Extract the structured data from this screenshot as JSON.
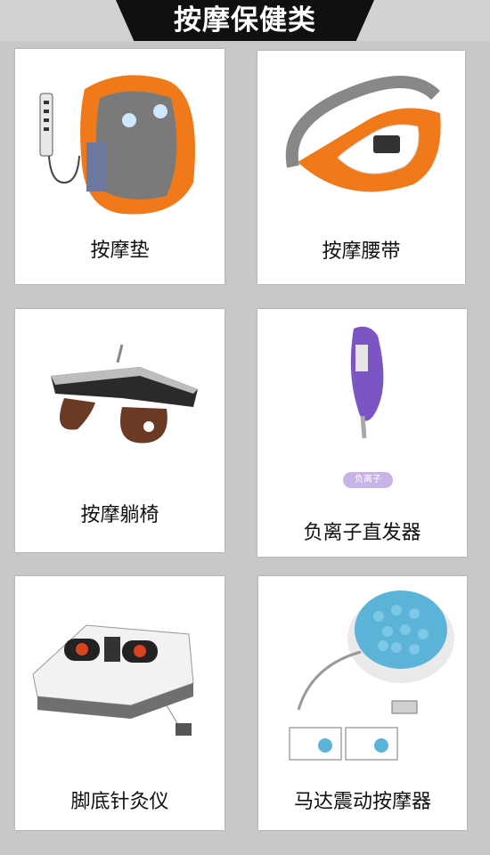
{
  "header": {
    "title": "按摩保健类"
  },
  "products": [
    {
      "label": "按摩垫"
    },
    {
      "label": "按摩腰带"
    },
    {
      "label": "按摩躺椅"
    },
    {
      "label": "负离子直发器",
      "tag": "负离子"
    },
    {
      "label": "脚底针灸仪"
    },
    {
      "label": "马达震动按摩器"
    }
  ],
  "colors": {
    "banner": "#101010",
    "background": "#c8c8c8",
    "card": "#ffffff"
  }
}
